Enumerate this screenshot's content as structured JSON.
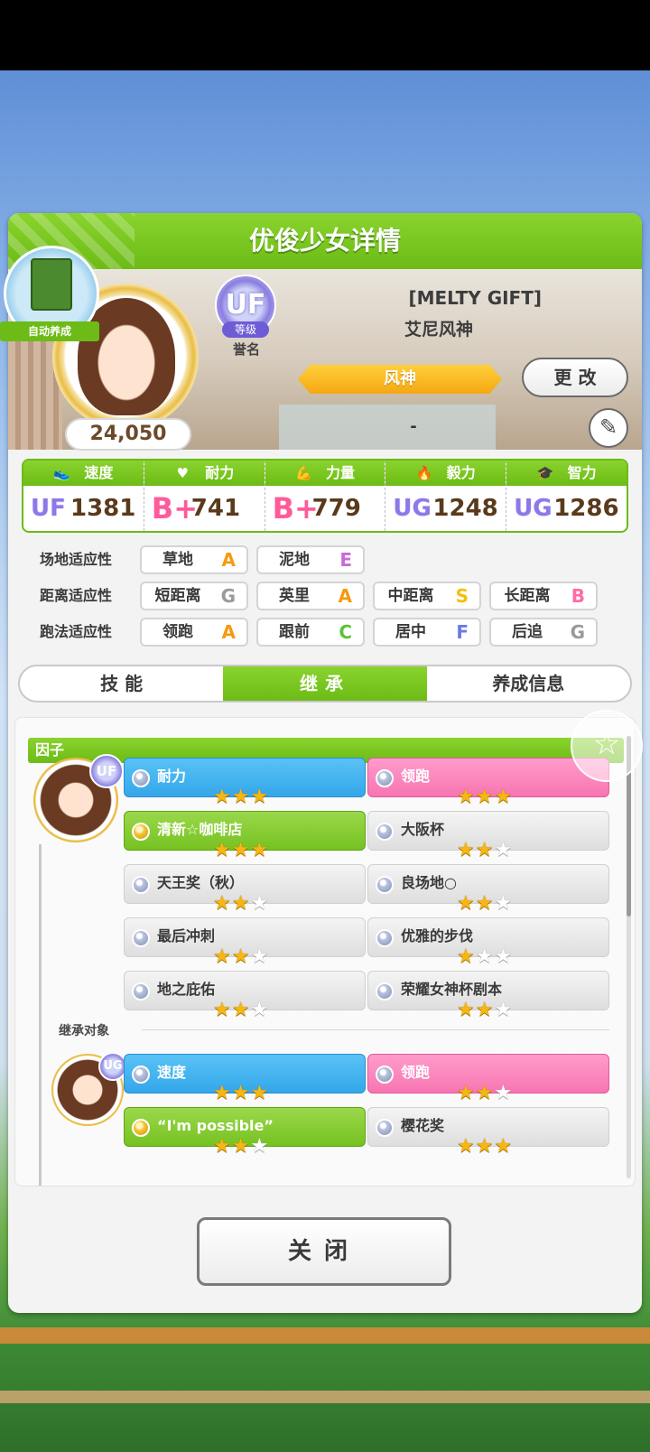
{
  "panel": {
    "title": "优俊少女详情"
  },
  "auto_train": {
    "label": "自动养成"
  },
  "character": {
    "title": "[MELTY GIFT]",
    "name": "艾尼风神",
    "rank_badge": "UF",
    "rank_sub": "等级",
    "rank_label": "誉名",
    "epithet": "风神",
    "score": "24,050",
    "second_label": "-"
  },
  "buttons": {
    "change": "更 改",
    "edit_icon": "✎",
    "close": "关闭"
  },
  "stats": [
    {
      "icon": "shoe-icon",
      "glyph": "👟",
      "label": "速度",
      "grade": "UF",
      "grade_class": "uf",
      "value": "1381"
    },
    {
      "icon": "heart-icon",
      "glyph": "♥",
      "label": "耐力",
      "grade": "B+",
      "grade_class": "b",
      "value": "741"
    },
    {
      "icon": "muscle-icon",
      "glyph": "💪",
      "label": "力量",
      "grade": "B+",
      "grade_class": "b",
      "value": "779"
    },
    {
      "icon": "flame-icon",
      "glyph": "🔥",
      "label": "毅力",
      "grade": "UG",
      "grade_class": "ug",
      "value": "1248"
    },
    {
      "icon": "graduation-cap-icon",
      "glyph": "🎓",
      "label": "智力",
      "grade": "UG",
      "grade_class": "ug",
      "value": "1286"
    }
  ],
  "aptitudes": {
    "track": {
      "label": "场地适应性",
      "items": [
        {
          "name": "草地",
          "grade": "A",
          "color": "#f59a12"
        },
        {
          "name": "泥地",
          "grade": "E",
          "color": "#c86ad8"
        }
      ]
    },
    "distance": {
      "label": "距离适应性",
      "items": [
        {
          "name": "短距离",
          "grade": "G",
          "color": "#9a9a9a"
        },
        {
          "name": "英里",
          "grade": "A",
          "color": "#f59a12"
        },
        {
          "name": "中距离",
          "grade": "S",
          "color": "#f2c00f"
        },
        {
          "name": "长距离",
          "grade": "B",
          "color": "#ff6aa8"
        }
      ]
    },
    "style": {
      "label": "跑法适应性",
      "items": [
        {
          "name": "领跑",
          "grade": "A",
          "color": "#f59a12"
        },
        {
          "name": "跟前",
          "grade": "C",
          "color": "#5cc23a"
        },
        {
          "name": "居中",
          "grade": "F",
          "color": "#6b7ae6"
        },
        {
          "name": "后追",
          "grade": "G",
          "color": "#9a9a9a"
        }
      ]
    }
  },
  "tabs": [
    {
      "label": "技 能",
      "active": false
    },
    {
      "label": "继承",
      "active": true
    },
    {
      "label": "养成信息",
      "active": false
    }
  ],
  "factors": {
    "header": "因子",
    "self_rank": "UF",
    "self": [
      {
        "name": "耐力",
        "color": "blue",
        "dot": "silver",
        "stars": 3
      },
      {
        "name": "领跑",
        "color": "pink",
        "dot": "silver",
        "stars": 3
      },
      {
        "name": "清新☆咖啡店",
        "color": "green",
        "dot": "gold",
        "stars": 3
      },
      {
        "name": "大阪杯",
        "color": "gray",
        "dot": "silver",
        "stars": 2
      },
      {
        "name": "天王奖（秋）",
        "color": "gray",
        "dot": "silver",
        "stars": 2
      },
      {
        "name": "良场地○",
        "color": "gray",
        "dot": "silver",
        "stars": 2
      },
      {
        "name": "最后冲刺",
        "color": "gray",
        "dot": "silver",
        "stars": 2
      },
      {
        "name": "优雅的步伐",
        "color": "gray",
        "dot": "silver",
        "stars": 1
      },
      {
        "name": "地之庇佑",
        "color": "gray",
        "dot": "silver",
        "stars": 2
      },
      {
        "name": "荣耀女神杯剧本",
        "color": "gray",
        "dot": "silver",
        "stars": 2
      }
    ],
    "inherit_label": "继承对象",
    "parent_rank": "UG",
    "parent": [
      {
        "name": "速度",
        "color": "blue",
        "dot": "silver",
        "stars": 3
      },
      {
        "name": "领跑",
        "color": "pink",
        "dot": "silver",
        "stars": 2
      },
      {
        "name": "“I'm possible”",
        "color": "green",
        "dot": "gold",
        "stars": 2
      },
      {
        "name": "樱花奖",
        "color": "gray",
        "dot": "silver",
        "stars": 3
      }
    ]
  }
}
